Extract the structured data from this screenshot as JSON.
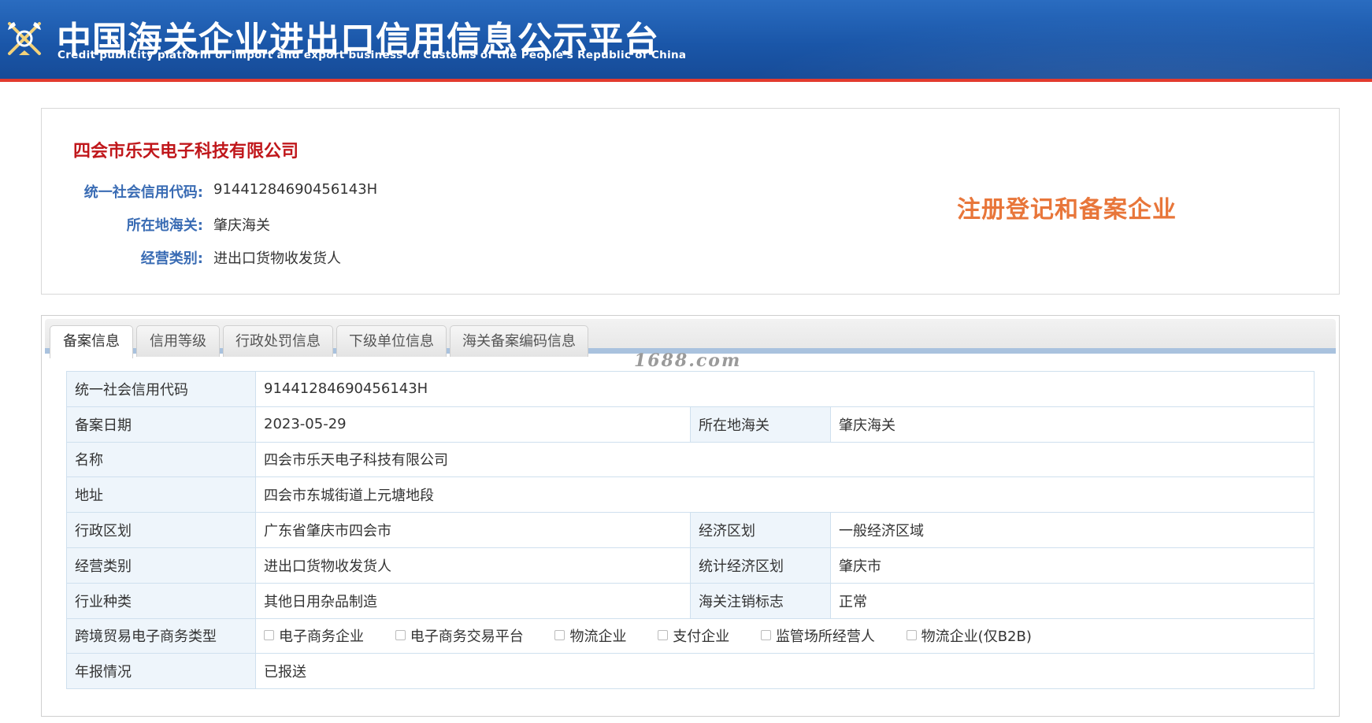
{
  "header": {
    "title": "中国海关企业进出口信用信息公示平台",
    "subtitle": "Credit publicity platform of import and export business of Customs of the People's Republic of China"
  },
  "summary": {
    "company_name": "四会市乐天电子科技有限公司",
    "rows": [
      {
        "label": "统一社会信用代码:",
        "value": "91441284690456143H"
      },
      {
        "label": "所在地海关:",
        "value": "肇庆海关"
      },
      {
        "label": "经营类别:",
        "value": "进出口货物收发货人"
      }
    ],
    "status_badge": "注册登记和备案企业"
  },
  "tabs": [
    {
      "label": "备案信息",
      "active": true
    },
    {
      "label": "信用等级",
      "active": false
    },
    {
      "label": "行政处罚信息",
      "active": false
    },
    {
      "label": "下级单位信息",
      "active": false
    },
    {
      "label": "海关备案编码信息",
      "active": false
    }
  ],
  "watermark": "1688.com",
  "table": {
    "credit_code": {
      "label": "统一社会信用代码",
      "value": "91441284690456143H"
    },
    "record_date": {
      "label": "备案日期",
      "value": "2023-05-29"
    },
    "customs": {
      "label": "所在地海关",
      "value": "肇庆海关"
    },
    "name": {
      "label": "名称",
      "value": "四会市乐天电子科技有限公司"
    },
    "address": {
      "label": "地址",
      "value": "四会市东城街道上元塘地段"
    },
    "admin_region": {
      "label": "行政区划",
      "value": "广东省肇庆市四会市"
    },
    "econ_region": {
      "label": "经济区划",
      "value": "一般经济区域"
    },
    "business_type": {
      "label": "经营类别",
      "value": "进出口货物收发货人"
    },
    "stat_region": {
      "label": "统计经济区划",
      "value": "肇庆市"
    },
    "industry": {
      "label": "行业种类",
      "value": "其他日用杂品制造"
    },
    "cancel_flag": {
      "label": "海关注销标志",
      "value": "正常"
    },
    "ecommerce": {
      "label": "跨境贸易电子商务类型",
      "options": [
        "电子商务企业",
        "电子商务交易平台",
        "物流企业",
        "支付企业",
        "监管场所经营人",
        "物流企业(仅B2B)"
      ]
    },
    "annual_report": {
      "label": "年报情况",
      "value": "已报送"
    }
  }
}
